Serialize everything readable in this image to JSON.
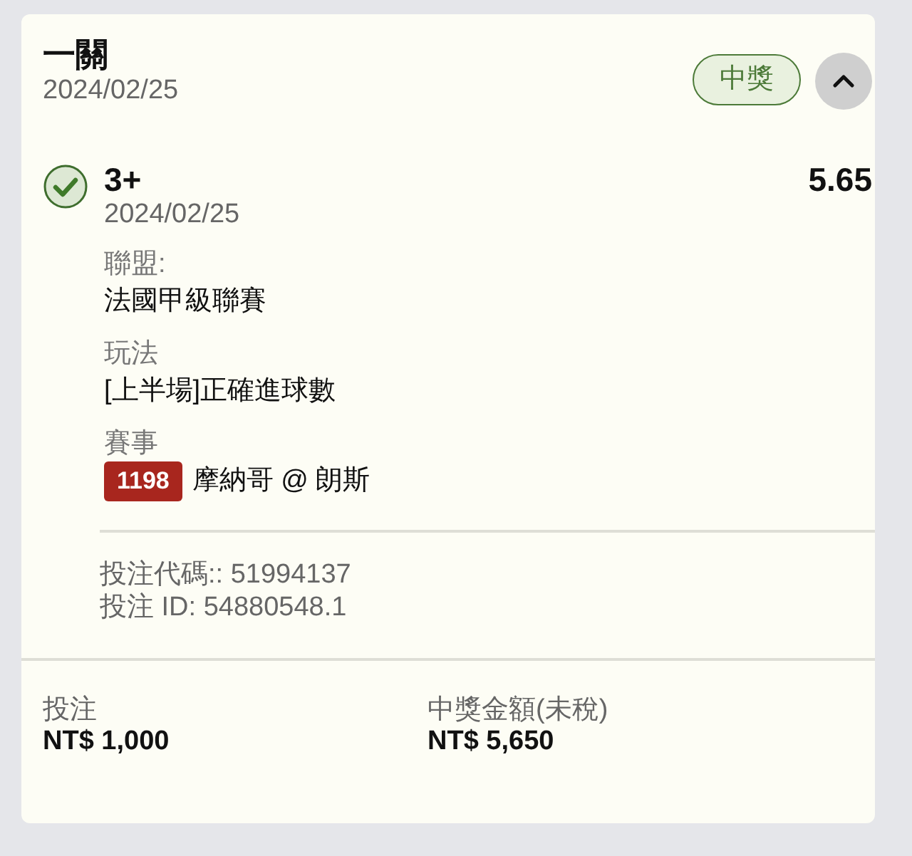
{
  "header": {
    "title": "一關",
    "date": "2024/02/25",
    "status": {
      "label": "中獎",
      "kind": "won"
    },
    "expanded": true
  },
  "selection": {
    "won": true,
    "name": "3+",
    "date": "2024/02/25",
    "odds": "5.65",
    "details": [
      {
        "label": "聯盟:",
        "value": "法國甲級聯賽"
      },
      {
        "label": "玩法",
        "value": "[上半場]正確進球數"
      },
      {
        "label": "賽事",
        "code": "1198",
        "value": "摩納哥 @ 朗斯"
      }
    ]
  },
  "refs": [
    "投注代碼:: 51994137",
    "投注 ID: 54880548.1"
  ],
  "totals": [
    {
      "label": "投注",
      "value": "NT$ 1,000"
    },
    {
      "label": "中獎金額(未稅)",
      "value": "NT$ 5,650"
    }
  ]
}
